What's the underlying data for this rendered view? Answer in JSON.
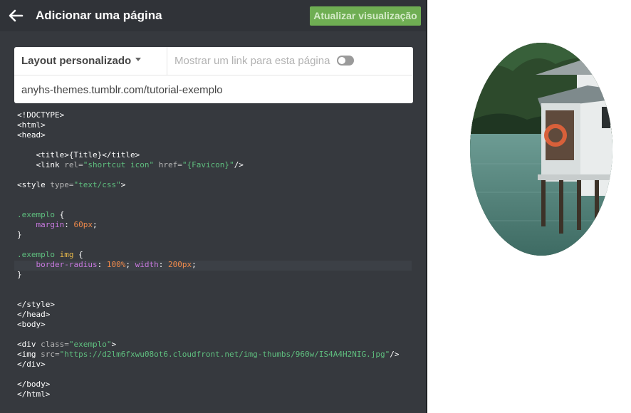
{
  "header": {
    "title": "Adicionar uma página",
    "update_label": "Atualizar visualização"
  },
  "settings": {
    "layout_label": "Layout personalizado",
    "show_link_label": "Mostrar um link para esta página",
    "url": "anyhs-themes.tumblr.com/tutorial-exemplo"
  },
  "code": {
    "lines": [
      [
        {
          "c": "t",
          "v": "<!DOCTYPE>"
        }
      ],
      [
        {
          "c": "t",
          "v": "<html>"
        }
      ],
      [
        {
          "c": "t",
          "v": "<head>"
        }
      ],
      [],
      [
        {
          "c": "t",
          "v": "    <title>{Title}</title>"
        }
      ],
      [
        {
          "c": "t",
          "v": "    <link "
        },
        {
          "c": "a",
          "v": "rel="
        },
        {
          "c": "s",
          "v": "\"shortcut icon\""
        },
        {
          "c": "a",
          "v": " href="
        },
        {
          "c": "s",
          "v": "\"{Favicon}\""
        },
        {
          "c": "t",
          "v": "/>"
        }
      ],
      [],
      [
        {
          "c": "t",
          "v": "<style "
        },
        {
          "c": "a",
          "v": "type="
        },
        {
          "c": "s",
          "v": "\"text/css\""
        },
        {
          "c": "t",
          "v": ">"
        }
      ],
      [],
      [],
      [
        {
          "c": "c",
          "v": ".exemplo"
        },
        {
          "c": "t",
          "v": " {"
        }
      ],
      [
        {
          "c": "t",
          "v": "    "
        },
        {
          "c": "p",
          "v": "margin"
        },
        {
          "c": "t",
          "v": ": "
        },
        {
          "c": "n",
          "v": "60px"
        },
        {
          "c": "t",
          "v": ";"
        }
      ],
      [
        {
          "c": "t",
          "v": "}"
        }
      ],
      [],
      [
        {
          "c": "c",
          "v": ".exemplo"
        },
        {
          "c": "t",
          "v": " "
        },
        {
          "c": "k",
          "v": "img"
        },
        {
          "c": "t",
          "v": " {"
        }
      ],
      [
        {
          "c": "t",
          "v": "    "
        },
        {
          "c": "p",
          "v": "border-radius"
        },
        {
          "c": "t",
          "v": ": "
        },
        {
          "c": "n",
          "v": "100%"
        },
        {
          "c": "t",
          "v": "; "
        },
        {
          "c": "p",
          "v": "width"
        },
        {
          "c": "t",
          "v": ": "
        },
        {
          "c": "n",
          "v": "200px"
        },
        {
          "c": "t",
          "v": ";"
        }
      ],
      [
        {
          "c": "t",
          "v": "}"
        }
      ],
      [],
      [],
      [
        {
          "c": "t",
          "v": "</style>"
        }
      ],
      [
        {
          "c": "t",
          "v": "</head>"
        }
      ],
      [
        {
          "c": "t",
          "v": "<body>"
        }
      ],
      [],
      [
        {
          "c": "t",
          "v": "<div "
        },
        {
          "c": "a",
          "v": "class="
        },
        {
          "c": "s",
          "v": "\"exemplo\""
        },
        {
          "c": "t",
          "v": ">"
        }
      ],
      [
        {
          "c": "t",
          "v": "<img "
        },
        {
          "c": "a",
          "v": "src="
        },
        {
          "c": "s",
          "v": "\"https://d2lm6fxwu08ot6.cloudfront.net/img-thumbs/960w/IS4A4H2NIG.jpg\""
        },
        {
          "c": "t",
          "v": "/>"
        }
      ],
      [
        {
          "c": "t",
          "v": "</div>"
        }
      ],
      [],
      [
        {
          "c": "t",
          "v": "</body>"
        }
      ],
      [
        {
          "c": "t",
          "v": "</html>"
        }
      ]
    ]
  },
  "colors": {
    "editor_bg": "#36393e",
    "topbar_bg": "#303338",
    "accent_green": "#6fae53"
  },
  "icons": {
    "back": "arrow-left-icon",
    "toggle": "toggle-switch-icon"
  },
  "preview": {
    "image": "stilt-house-over-water-photo"
  }
}
